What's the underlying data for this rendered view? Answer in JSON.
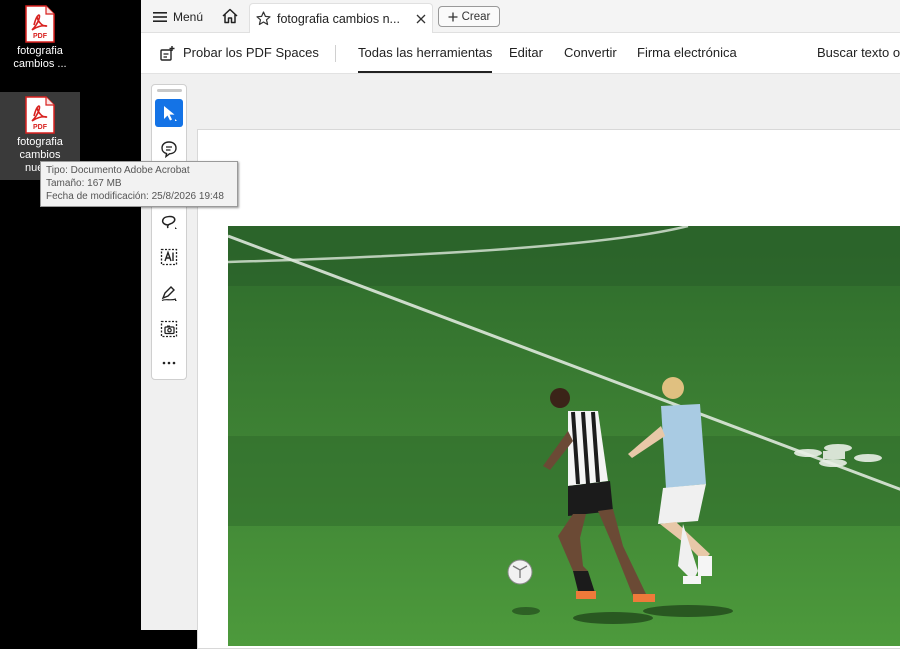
{
  "desktop": {
    "icons": [
      {
        "label_line1": "fotografia",
        "label_line2": "cambios ...",
        "icon": "pdf-file-icon"
      },
      {
        "label_line1": "fotografia",
        "label_line2": "cambios",
        "label_line3": "nuevo",
        "icon": "pdf-file-icon"
      }
    ],
    "pdf_badge": "PDF",
    "tooltip": {
      "type": "Tipo: Documento Adobe Acrobat",
      "size": "Tamaño: 167 MB",
      "modified": "Fecha de modificación: 25/8/2026 19:48"
    }
  },
  "tabbar": {
    "menu_label": "Menú",
    "tab_title": "fotografia cambios n...",
    "create_label": "Crear"
  },
  "toolbar": {
    "try_spaces": "Probar los PDF Spaces",
    "items": [
      "Todas las herramientas",
      "Editar",
      "Convertir",
      "Firma electrónica"
    ],
    "search": "Buscar texto o"
  },
  "tools": [
    "select-cursor-icon",
    "comment-icon",
    "draw-icon",
    "lasso-icon",
    "text-recognition-icon",
    "sign-icon",
    "snapshot-icon",
    "more-icon"
  ],
  "colors": {
    "accent": "#1473e6",
    "pdf_red": "#d8211f",
    "grass": "#3f7d2f"
  }
}
